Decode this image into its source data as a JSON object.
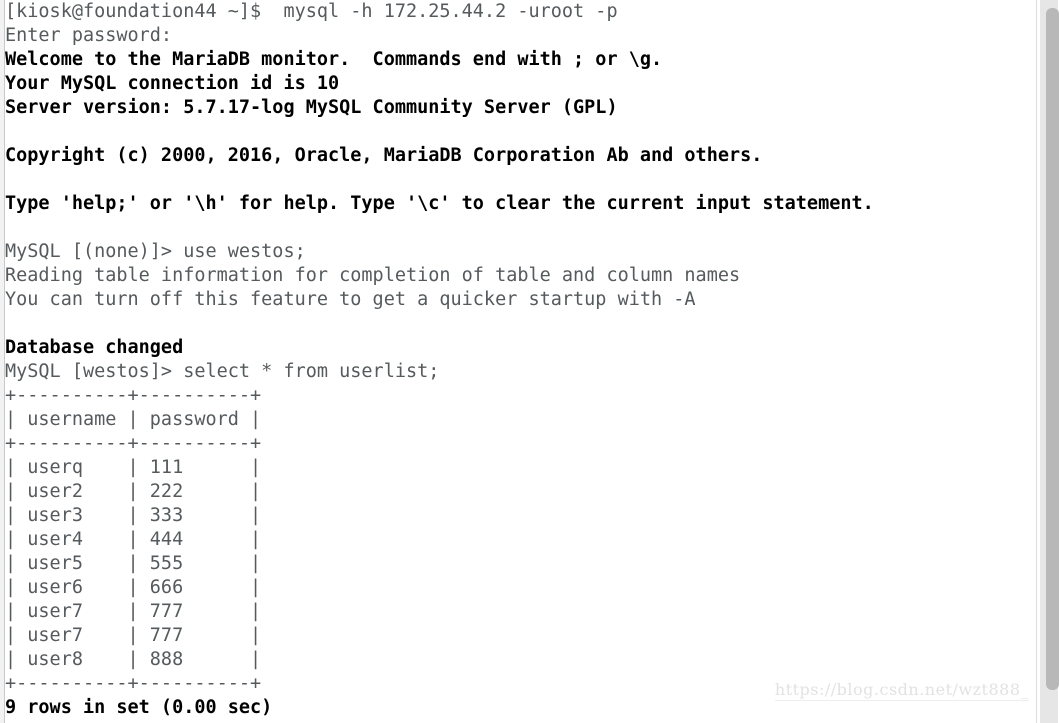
{
  "terminal": {
    "prompt_host": "[kiosk@foundation44 ~]$",
    "scrollbar": {
      "thumb_label": "vertical-scroll-thumb"
    },
    "lines": [
      {
        "text": "[kiosk@foundation44 ~]$  mysql -h 172.25.44.2 -uroot -p",
        "bold": false
      },
      {
        "text": "Enter password:",
        "bold": false
      },
      {
        "text": "Welcome to the MariaDB monitor.  Commands end with ; or \\g.",
        "bold": true
      },
      {
        "text": "Your MySQL connection id is 10",
        "bold": true
      },
      {
        "text": "Server version: 5.7.17-log MySQL Community Server (GPL)",
        "bold": true
      },
      {
        "text": "",
        "bold": false
      },
      {
        "text": "Copyright (c) 2000, 2016, Oracle, MariaDB Corporation Ab and others.",
        "bold": true
      },
      {
        "text": "",
        "bold": false
      },
      {
        "text": "Type 'help;' or '\\h' for help. Type '\\c' to clear the current input statement.",
        "bold": true
      },
      {
        "text": "",
        "bold": false
      },
      {
        "text": "MySQL [(none)]> use westos;",
        "bold": false
      },
      {
        "text": "Reading table information for completion of table and column names",
        "bold": false
      },
      {
        "text": "You can turn off this feature to get a quicker startup with -A",
        "bold": false
      },
      {
        "text": "",
        "bold": false
      },
      {
        "text": "Database changed",
        "bold": true
      },
      {
        "text": "MySQL [westos]> select * from userlist;",
        "bold": false
      },
      {
        "text": "+----------+----------+",
        "bold": false
      },
      {
        "text": "| username | password |",
        "bold": false
      },
      {
        "text": "+----------+----------+",
        "bold": false
      },
      {
        "text": "| userq    | 111      |",
        "bold": false
      },
      {
        "text": "| user2    | 222      |",
        "bold": false
      },
      {
        "text": "| user3    | 333      |",
        "bold": false
      },
      {
        "text": "| user4    | 444      |",
        "bold": false
      },
      {
        "text": "| user5    | 555      |",
        "bold": false
      },
      {
        "text": "| user6    | 666      |",
        "bold": false
      },
      {
        "text": "| user7    | 777      |",
        "bold": false
      },
      {
        "text": "| user7    | 777      |",
        "bold": false
      },
      {
        "text": "| user8    | 888      |",
        "bold": false
      },
      {
        "text": "+----------+----------+",
        "bold": false
      },
      {
        "text": "9 rows in set (0.00 sec)",
        "bold": true
      }
    ],
    "session": {
      "command_connect": "mysql -h 172.25.44.2 -uroot -p",
      "password_prompt": "Enter password:",
      "server_host": "172.25.44.2",
      "user": "root",
      "connection_id": "10",
      "server_version": "5.7.17-log MySQL Community Server (GPL)",
      "copyright": "Copyright (c) 2000, 2016, Oracle, MariaDB Corporation Ab and others.",
      "database": "westos",
      "command_use": "use westos;",
      "command_select": "select * from userlist;",
      "result_status": "9 rows in set (0.00 sec)",
      "database_changed": "Database changed"
    },
    "table": {
      "name": "userlist",
      "columns": [
        "username",
        "password"
      ],
      "rows": [
        [
          "userq",
          "111"
        ],
        [
          "user2",
          "222"
        ],
        [
          "user3",
          "333"
        ],
        [
          "user4",
          "444"
        ],
        [
          "user5",
          "555"
        ],
        [
          "user6",
          "666"
        ],
        [
          "user7",
          "777"
        ],
        [
          "user7",
          "777"
        ],
        [
          "user8",
          "888"
        ]
      ],
      "row_count": "9"
    }
  },
  "watermark": {
    "text": "https://blog.csdn.net/wzt888_"
  },
  "colors": {
    "background": "#ffffff",
    "text_bold": "#000000",
    "text_normal": "#555a5d",
    "scrollbar_thumb": "#b8b8b8",
    "scrollbar_track": "#e6e6e6",
    "watermark": "#e2e2e2"
  }
}
